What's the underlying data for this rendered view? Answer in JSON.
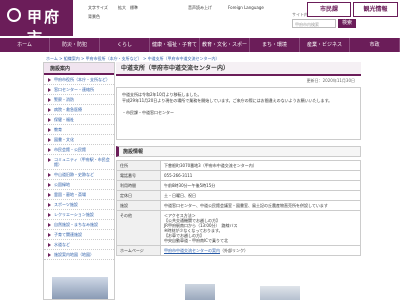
{
  "header": {
    "logo_text": "甲府市",
    "top_links": [
      "文字サイズ",
      "拡大",
      "標準",
      "背景色",
      "音声読み上げ",
      "Foreign Language"
    ],
    "search_placeholder": "甲府市内検索",
    "search_button": "検索",
    "search_tabs": [
      "サイト内検索",
      "組織から探す"
    ],
    "btn_shimin": "市民課",
    "btn_kanko": "観光情報"
  },
  "nav": [
    "ホーム",
    "防災・防犯",
    "くらし",
    "健康・福祉・子育て",
    "教育・文化・スポーツ",
    "まち・環境",
    "産業・ビジネス",
    "市政"
  ],
  "breadcrumb": "ホーム > 組織案内 > 甲府市役所（本庁・支所など） > 中道支所（甲府市中道交流センター内）",
  "sidebar": {
    "heading": "施設案内",
    "items": [
      "甲府市役所（本庁・支所など）",
      "窓口センター・連絡所",
      "警察・消防",
      "病院・救急医療",
      "保健・福祉",
      "教育",
      "図書・文化",
      "市民会館・公民館",
      "コミュニティ（甲府駅・市民会館）",
      "中山道旧跡・史跡など",
      "公園緑地",
      "霊園・墓地・斎場",
      "スポーツ施設",
      "レクリエーション施設",
      "自然施設・まちなみ施設",
      "子育て関連施設",
      "水道など",
      "施設案内地図（地図）"
    ]
  },
  "main": {
    "title": "中道支所（甲府市中道交流センター内）",
    "date": "更新日：2020年11月30日",
    "notice_lines": [
      "中道支所は令和2年10月より移転しました。",
      "平成29年11月20日より現在の場所で業務を開始しています。ご来庁の際にはお間違えのないようお願いいたします。",
      "",
      "・市民課・中道窓口センター"
    ],
    "section_heading": "施設情報",
    "rows": [
      {
        "k": "住所",
        "v": "下曽根町3070番地3（甲府市中道交流センター内）"
      },
      {
        "k": "電話番号",
        "v": "055-266-3111"
      },
      {
        "k": "利用時間",
        "v": "午前8時30分～午後5時15分"
      },
      {
        "k": "定休日",
        "v": "土・日曜日、祝日"
      },
      {
        "k": "施設",
        "v": "中道窓口センター、中道公民館会議室・図書室、風土記の丘農産物直売所を併設しています"
      },
      {
        "k": "その他",
        "v": "＜アクセス方法＞\n【公共交通機関でお越しの方】\nJR甲府駅南口から（13:00分）　路線バス\n※時刻が少なくなっております。\n【お車でお越しの方】\n中央自動車道・甲府南ICで乗りて北"
      },
      {
        "k": "ホームページ",
        "v": "（外部リンク）"
      }
    ],
    "homepage_link": "甲府市中道交流センターの案内"
  }
}
